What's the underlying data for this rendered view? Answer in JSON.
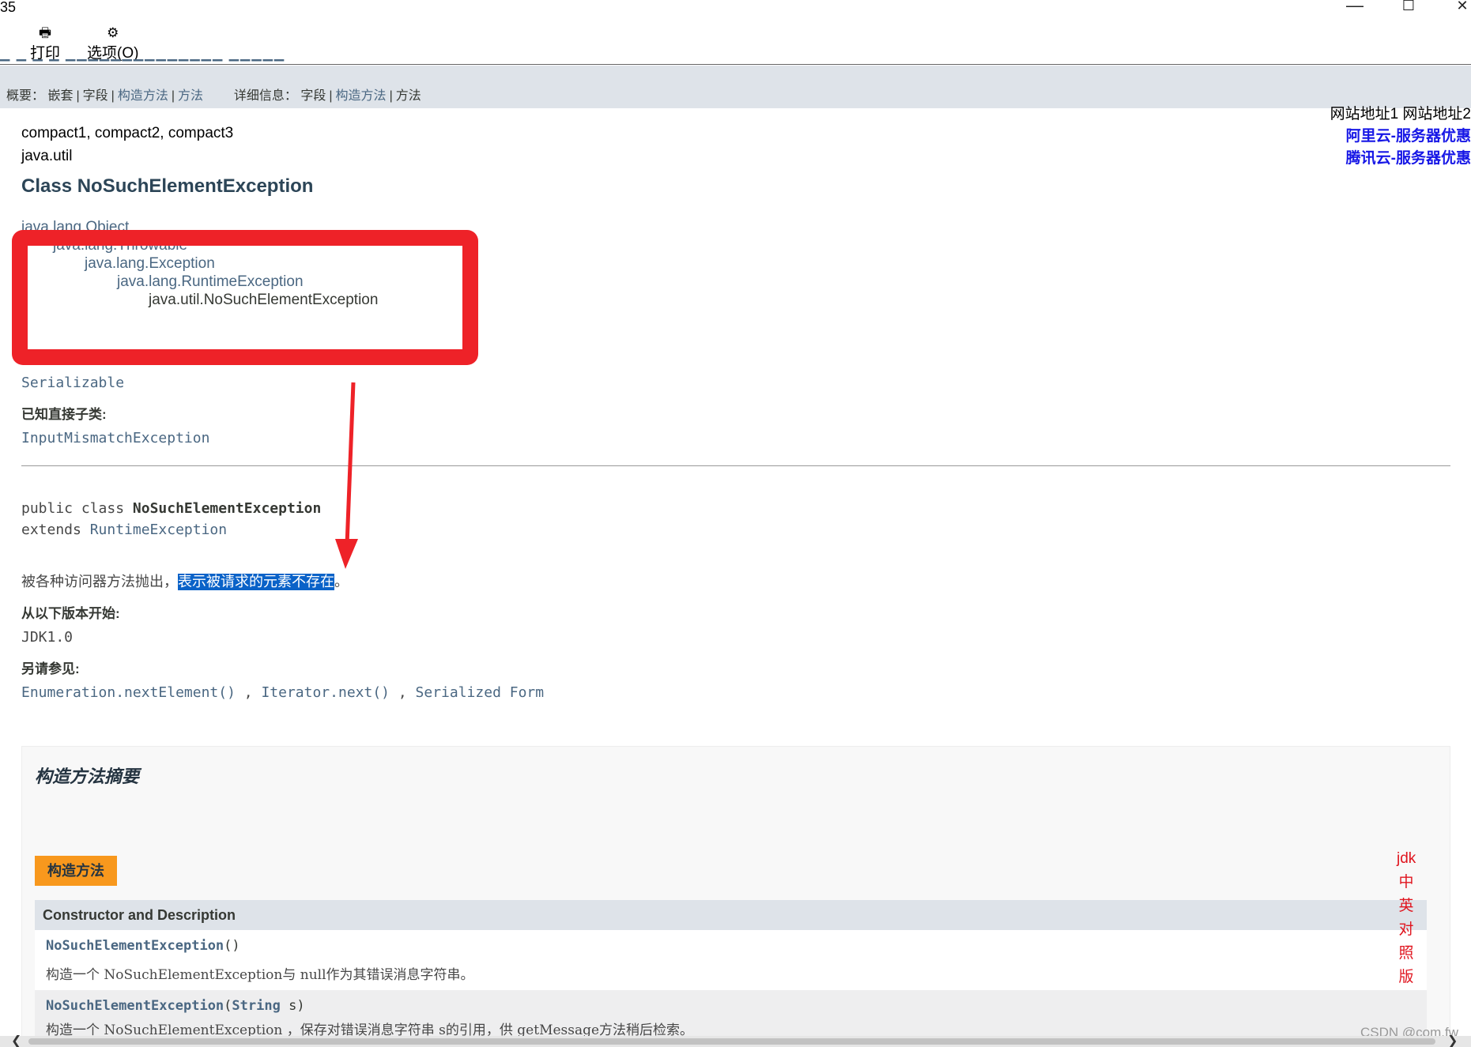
{
  "window": {
    "title_fragment": "35",
    "minimize": "—",
    "maximize": "☐",
    "close": "✕"
  },
  "toolbar": {
    "print_icon": "print-icon",
    "print_label": "打印",
    "options_icon": "options-icon",
    "options_label": "选项(O)"
  },
  "subnav": {
    "summary_label": "概要：",
    "summary_items": [
      "嵌套",
      "字段",
      "构造方法",
      "方法"
    ],
    "detail_label": "详细信息：",
    "detail_items": [
      "字段",
      "构造方法",
      "方法"
    ]
  },
  "side_links": {
    "site1": "网站地址1",
    "site2": "网站地址2",
    "aliyun": "阿里云-服务器优惠",
    "tencent": "腾讯云-服务器优惠"
  },
  "profiles": "compact1, compact2, compact3",
  "package": "java.util",
  "class_title": "Class NoSuchElementException",
  "hierarchy": [
    "java.lang.Object",
    "java.lang.Throwable",
    "java.lang.Exception",
    "java.lang.RuntimeException",
    "java.util.NoSuchElementException"
  ],
  "interfaces": "Serializable",
  "subclasses_label": "已知直接子类:",
  "subclass": "InputMismatchException",
  "signature": {
    "line1_prefix": "public class ",
    "class_name": "NoSuchElementException",
    "extends_kw": "extends ",
    "parent": "RuntimeException"
  },
  "description": {
    "before": "被各种访问器方法抛出，",
    "selected": "表示被请求的元素不存在",
    "after": "。"
  },
  "since_label": "从以下版本开始:",
  "since_value": "JDK1.0",
  "see_also_label": "另请参见:",
  "see_also": [
    "Enumeration.nextElement()",
    "Iterator.next()",
    "Serialized Form"
  ],
  "see_sep": " , ",
  "constructor_summary": {
    "title": "构造方法摘要",
    "caption": "构造方法",
    "header": "Constructor and Description",
    "rows": [
      {
        "name": "NoSuchElementException",
        "params": "()",
        "desc": "构造一个 NoSuchElementException与 null作为其错误消息字符串。"
      },
      {
        "name": "NoSuchElementException",
        "params_open": "(",
        "param_type": "String",
        "param_name": " s)",
        "desc": "构造一个 NoSuchElementException ，保存对错误消息字符串 s的引用，供 getMessage方法稍后检索。"
      }
    ]
  },
  "side_vertical": [
    "jdk",
    "中",
    "英",
    "对",
    "照",
    "版"
  ],
  "watermark": "CSDN @com.fw",
  "annotation_colors": {
    "box": "#ee2228",
    "selection": "#0a62c8",
    "caption": "#f8981d"
  }
}
